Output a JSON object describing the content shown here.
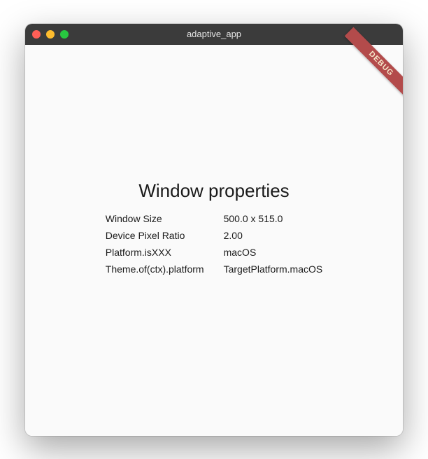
{
  "window": {
    "title": "adaptive_app"
  },
  "debug": {
    "ribbon_label": "DEBUG"
  },
  "main": {
    "heading": "Window properties",
    "rows": [
      {
        "key": "Window Size",
        "value": "500.0 x 515.0"
      },
      {
        "key": "Device Pixel Ratio",
        "value": "2.00"
      },
      {
        "key": "Platform.isXXX",
        "value": "macOS"
      },
      {
        "key": "Theme.of(ctx).platform",
        "value": "TargetPlatform.macOS"
      }
    ]
  },
  "colors": {
    "titlebar_bg": "#3b3b3b",
    "content_bg": "#fafafa",
    "ribbon_bg": "#b34b4b",
    "ribbon_fg": "#f5e6c8",
    "traffic_close": "#ff5f57",
    "traffic_min": "#febc2e",
    "traffic_max": "#28c840"
  }
}
